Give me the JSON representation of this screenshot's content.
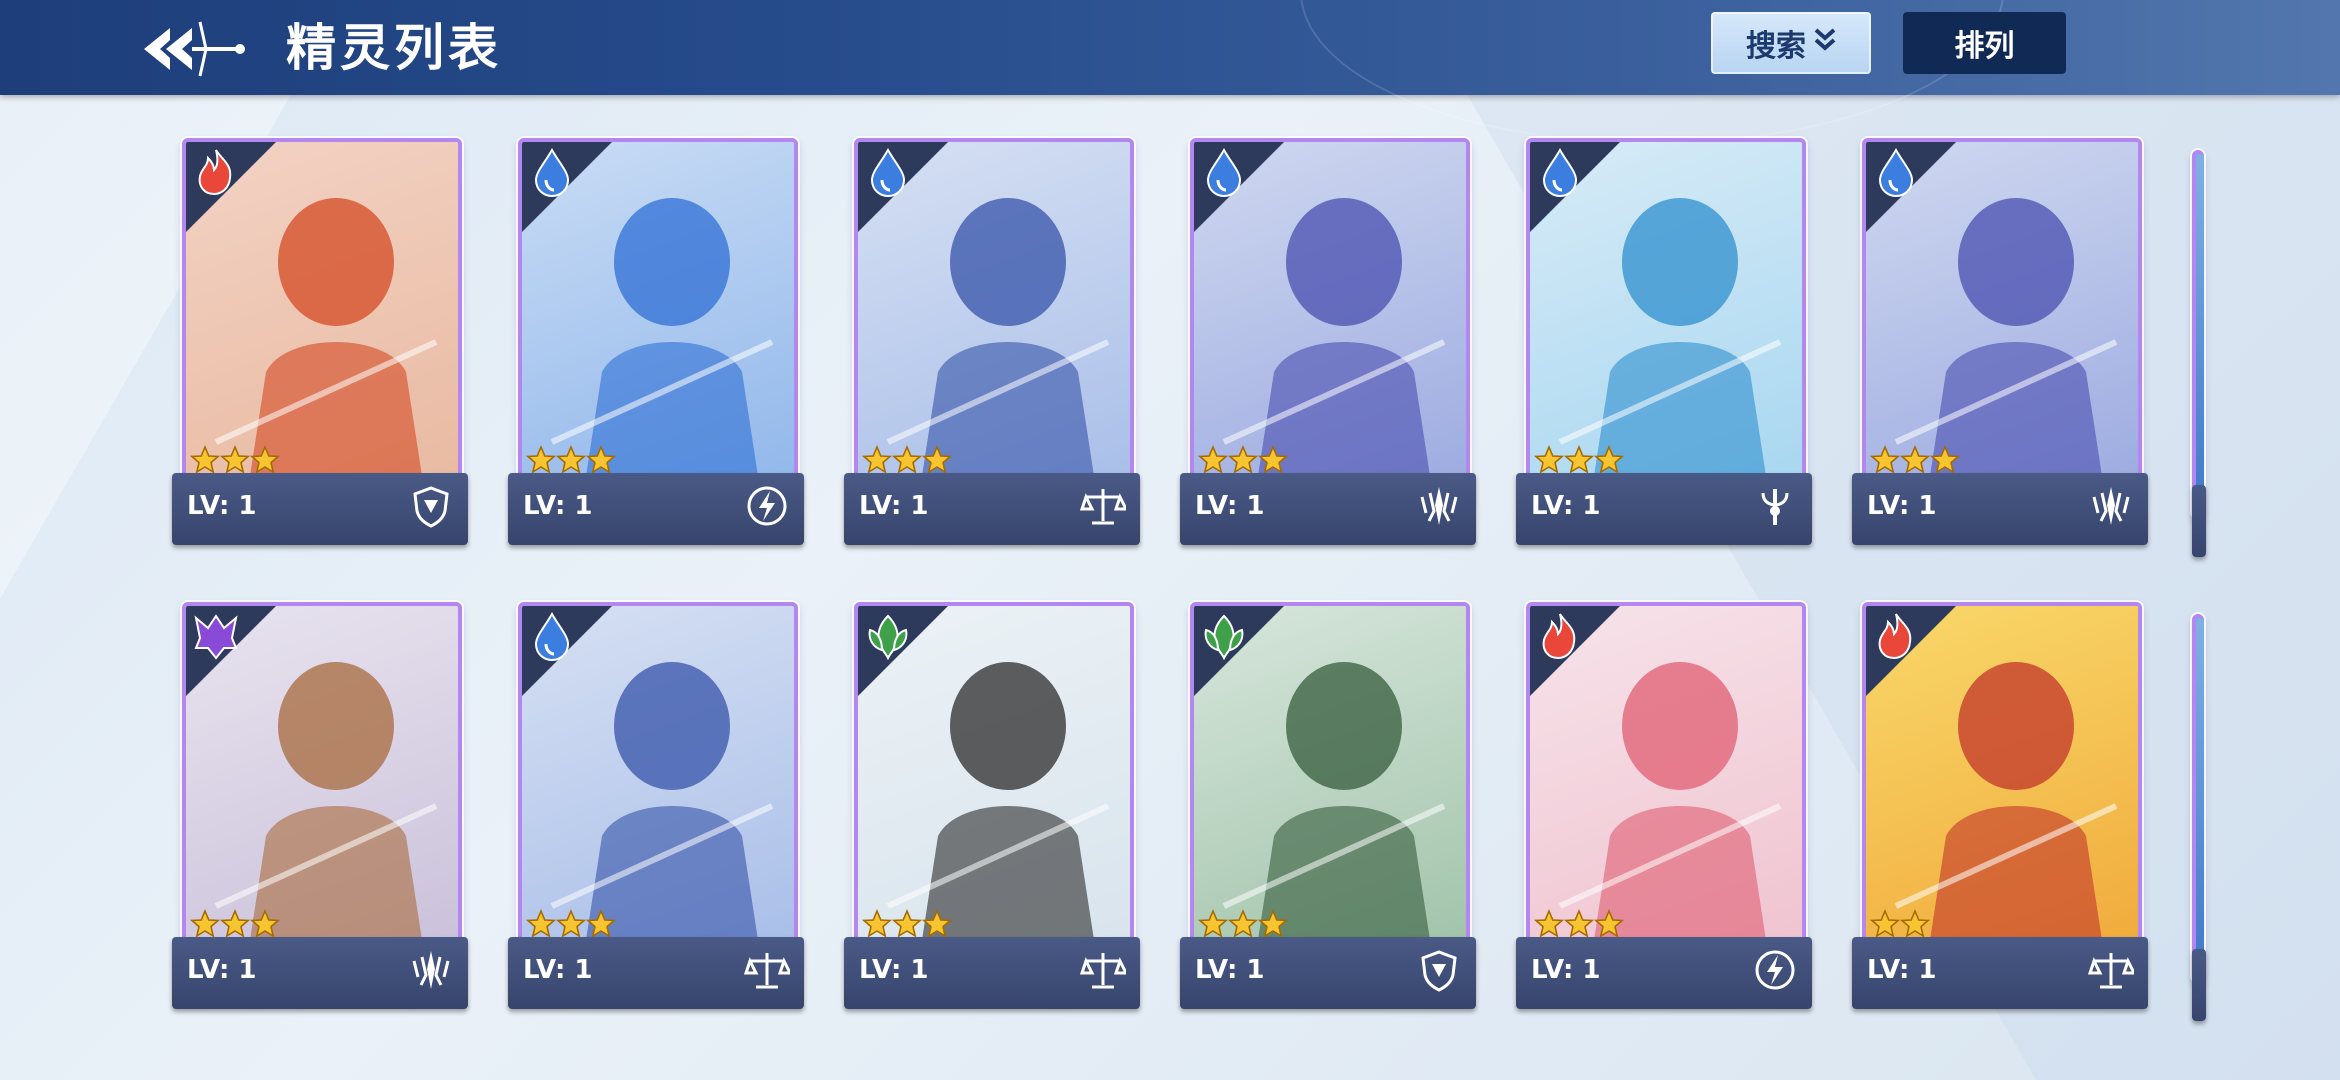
{
  "header": {
    "title": "精灵列表",
    "search_label": "搜索",
    "sort_label": "排列"
  },
  "cards": [
    {
      "lv": "LV: 1",
      "element": "fire",
      "role": "shield",
      "stars": 3,
      "bg": [
        "#f3d2c4",
        "#e8b9a0"
      ],
      "accent": "#d44a23"
    },
    {
      "lv": "LV: 1",
      "element": "water",
      "role": "lightning",
      "stars": 3,
      "bg": [
        "#c9dcf5",
        "#8fb6ea"
      ],
      "accent": "#2f6fd6"
    },
    {
      "lv": "LV: 1",
      "element": "water",
      "role": "balance",
      "stars": 3,
      "bg": [
        "#d6e0f3",
        "#a7bde8"
      ],
      "accent": "#3553a9"
    },
    {
      "lv": "LV: 1",
      "element": "water",
      "role": "blade",
      "stars": 3,
      "bg": [
        "#cfd8f0",
        "#9ba9e0"
      ],
      "accent": "#4a4fb0"
    },
    {
      "lv": "LV: 1",
      "element": "water",
      "role": "staff",
      "stars": 3,
      "bg": [
        "#d7ebf7",
        "#a6d6f0"
      ],
      "accent": "#2f8fcf"
    },
    {
      "lv": "LV: 1",
      "element": "water",
      "role": "blade",
      "stars": 3,
      "bg": [
        "#cfd8f0",
        "#9ba9e0"
      ],
      "accent": "#4a4fb0"
    },
    {
      "lv": "LV: 1",
      "element": "dark",
      "role": "blade",
      "stars": 3,
      "bg": [
        "#e8e3ef",
        "#c9c0d9"
      ],
      "accent": "#a86a3c"
    },
    {
      "lv": "LV: 1",
      "element": "water",
      "role": "balance",
      "stars": 3,
      "bg": [
        "#d6e0f3",
        "#a7bde8"
      ],
      "accent": "#3553a9"
    },
    {
      "lv": "LV: 1",
      "element": "grass",
      "role": "balance",
      "stars": 3,
      "bg": [
        "#ecf2f6",
        "#d7e3ec"
      ],
      "accent": "#2b2b2b"
    },
    {
      "lv": "LV: 1",
      "element": "grass",
      "role": "shield",
      "stars": 3,
      "bg": [
        "#d7e6dc",
        "#9fc2a8"
      ],
      "accent": "#355c3c"
    },
    {
      "lv": "LV: 1",
      "element": "fire",
      "role": "lightning",
      "stars": 3,
      "bg": [
        "#f7e3ea",
        "#efc2cf"
      ],
      "accent": "#e05d72"
    },
    {
      "lv": "LV: 1",
      "element": "fire",
      "role": "balance",
      "stars": 2,
      "bg": [
        "#f9d86a",
        "#f0a93a"
      ],
      "accent": "#c2362a"
    }
  ],
  "icons": {
    "back": "back-arrow-icon",
    "search_chevron": "double-chevron-down-icon",
    "elements": {
      "fire": "fire-icon",
      "water": "water-drop-icon",
      "grass": "leaf-icon",
      "dark": "dark-demon-icon"
    },
    "roles": {
      "shield": "shield-icon",
      "lightning": "lightning-icon",
      "balance": "balance-scale-icon",
      "blade": "blade-icon",
      "staff": "staff-icon"
    }
  },
  "colors": {
    "fire": "#e8473a",
    "water": "#3b7ee0",
    "grass": "#3fa04a",
    "dark": "#8a4ad8",
    "card_border": "#b487f0"
  }
}
